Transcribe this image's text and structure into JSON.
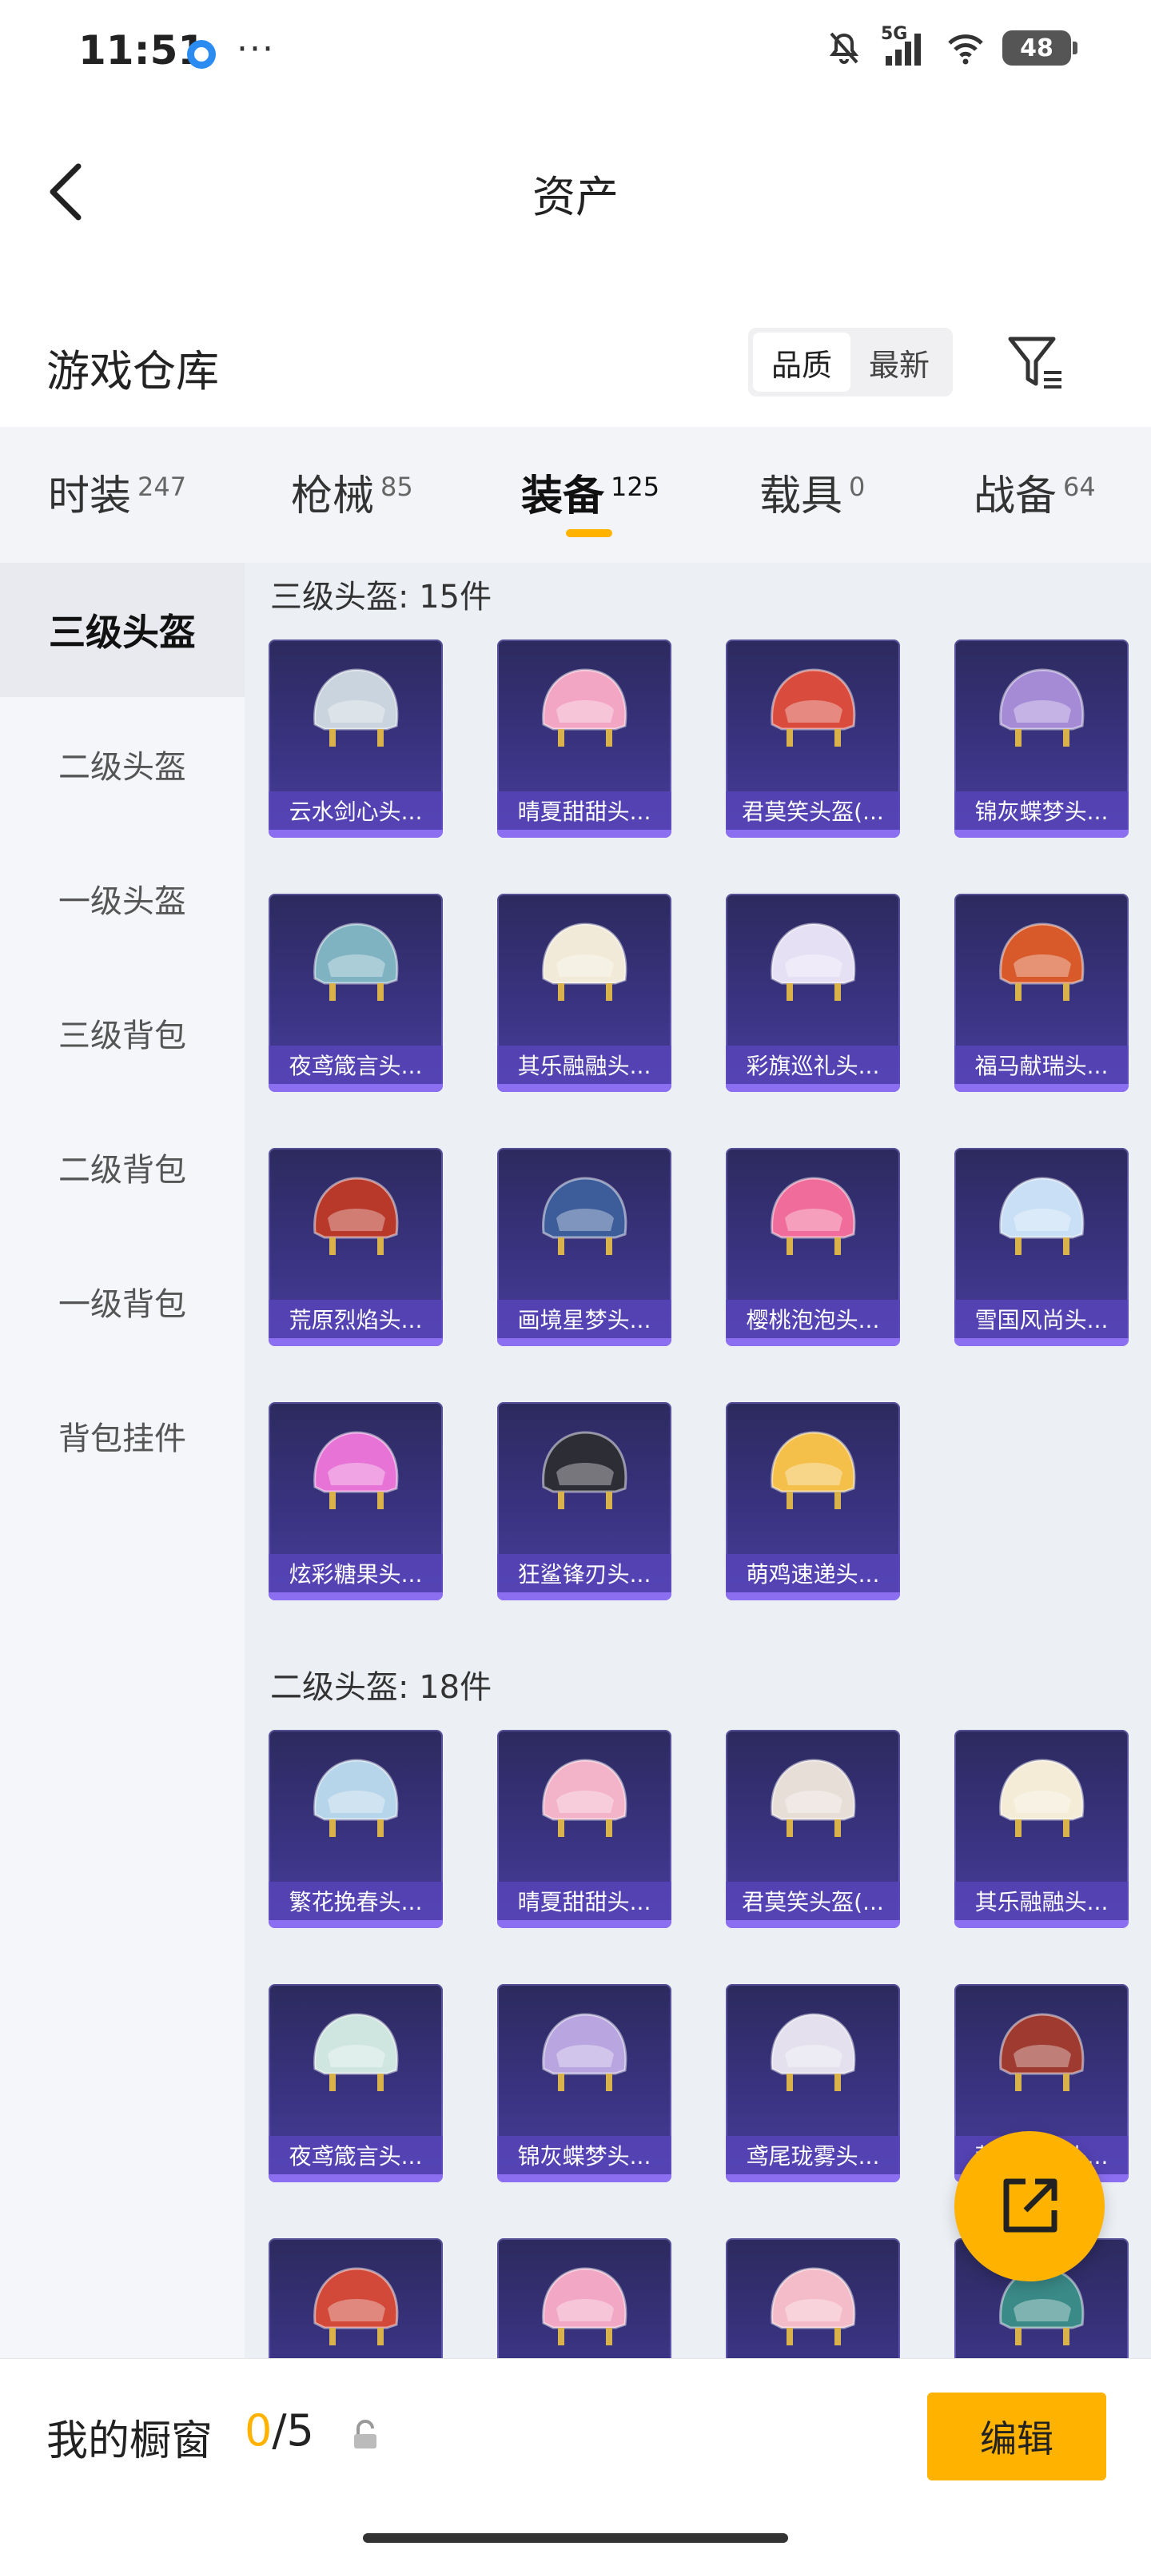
{
  "status": {
    "time": "11:51",
    "dots": "···",
    "network": "5G",
    "battery": "48"
  },
  "header": {
    "title": "资产"
  },
  "warehouse": {
    "title": "游戏仓库",
    "sort_options": [
      "品质",
      "最新"
    ],
    "selected_sort": "品质"
  },
  "categories": [
    {
      "label": "时装",
      "count": "247"
    },
    {
      "label": "枪械",
      "count": "85"
    },
    {
      "label": "装备",
      "count": "125",
      "active": true
    },
    {
      "label": "载具",
      "count": "0"
    },
    {
      "label": "战备",
      "count": "64"
    }
  ],
  "sidebar": {
    "items": [
      "三级头盔",
      "二级头盔",
      "一级头盔",
      "三级背包",
      "二级背包",
      "一级背包",
      "背包挂件"
    ],
    "active": "三级头盔"
  },
  "sections": [
    {
      "title": "三级头盔: 15件",
      "items": [
        {
          "name": "云水剑心头...",
          "color": "#c9d4de"
        },
        {
          "name": "晴夏甜甜头...",
          "color": "#f3a6c4"
        },
        {
          "name": "君莫笑头盔(...",
          "color": "#d94b3c"
        },
        {
          "name": "锦灰蝶梦头...",
          "color": "#a58ad6"
        },
        {
          "name": "夜鸢箴言头...",
          "color": "#7fb3c2"
        },
        {
          "name": "其乐融融头...",
          "color": "#f2ead8"
        },
        {
          "name": "彩旗巡礼头...",
          "color": "#e6e0f5"
        },
        {
          "name": "福马献瑞头...",
          "color": "#d85a2a"
        },
        {
          "name": "荒原烈焰头...",
          "color": "#b8382a"
        },
        {
          "name": "画境星梦头...",
          "color": "#3c5c9a"
        },
        {
          "name": "樱桃泡泡头...",
          "color": "#f06c9a"
        },
        {
          "name": "雪国风尚头...",
          "color": "#c8dff5"
        },
        {
          "name": "炫彩糖果头...",
          "color": "#e873d6"
        },
        {
          "name": "狂鲨锋刃头...",
          "color": "#2d2d36"
        },
        {
          "name": "萌鸡速递头...",
          "color": "#f4c04a"
        }
      ]
    },
    {
      "title": "二级头盔: 18件",
      "items": [
        {
          "name": "繁花挽春头...",
          "color": "#b6d4ea"
        },
        {
          "name": "晴夏甜甜头...",
          "color": "#f3b3c8"
        },
        {
          "name": "君莫笑头盔(...",
          "color": "#e8ded8"
        },
        {
          "name": "其乐融融头...",
          "color": "#f4ecd6"
        },
        {
          "name": "夜鸢箴言头...",
          "color": "#cfe6e0"
        },
        {
          "name": "锦灰蝶梦头...",
          "color": "#b9a6e0"
        },
        {
          "name": "鸢尾珑雾头...",
          "color": "#e4e0ee"
        },
        {
          "name": "荒原烈焰头...",
          "color": "#9e3a30"
        },
        {
          "name": "",
          "color": "#d2493a"
        },
        {
          "name": "",
          "color": "#f2a8c4"
        },
        {
          "name": "",
          "color": "#f4bcc8"
        },
        {
          "name": "",
          "color": "#3a8a88"
        }
      ]
    }
  ],
  "bottom": {
    "title": "我的橱窗",
    "count_current": "0",
    "count_total": "/5",
    "edit_label": "编辑"
  }
}
